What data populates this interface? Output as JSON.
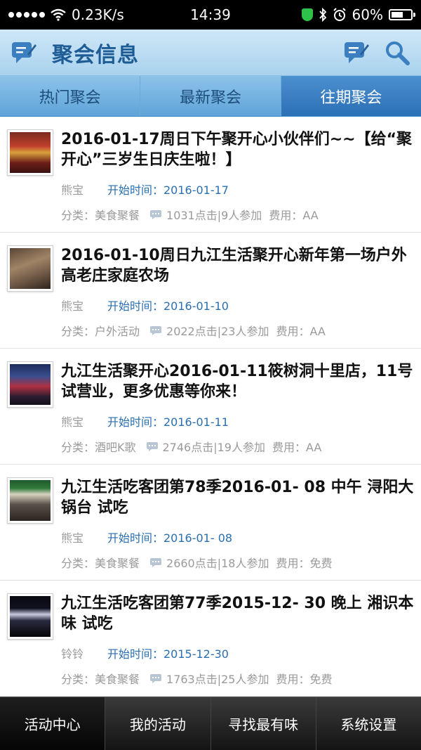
{
  "status": {
    "speed": "0.23K/s",
    "time": "14:39",
    "battery": "60%",
    "battery_level": 0.6
  },
  "header": {
    "title": "聚会信息"
  },
  "tabs": [
    {
      "label": "热门聚会"
    },
    {
      "label": "最新聚会"
    },
    {
      "label": "往期聚会"
    }
  ],
  "events": [
    {
      "title": "2016-01-17周日下午聚开心小伙伴们~~【给“聚开心”三岁生日庆生啦！】",
      "author": "熊宝",
      "start": "开始时间：2016-01-17",
      "category": "分类：美食聚餐",
      "stats": "1031点击|9人参加",
      "fee": "费用：AA"
    },
    {
      "title": "2016-01-10周日九江生活聚开心新年第一场户外 高老庄家庭农场",
      "author": "熊宝",
      "start": "开始时间：2016-01-10",
      "category": "分类：户外活动",
      "stats": "2022点击|23人参加",
      "fee": "费用：AA"
    },
    {
      "title": "九江生活聚开心2016-01-11筱树洞十里店，11号试营业，更多优惠等你来！",
      "author": "熊宝",
      "start": "开始时间：2016-01-11",
      "category": "分类：酒吧K歌",
      "stats": "2746点击|19人参加",
      "fee": "费用：AA"
    },
    {
      "title": "九江生活吃客团第78季2016-01- 08 中午 浔阳大锅台 试吃",
      "author": "熊宝",
      "start": "开始时间：2016-01- 08",
      "category": "分类：美食聚餐",
      "stats": "2660点击|18人参加",
      "fee": "费用：免费"
    },
    {
      "title": "九江生活吃客团第77季2015-12- 30 晚上 湘识本味 试吃",
      "author": "铃铃",
      "start": "开始时间：2015-12-30",
      "category": "分类：美食聚餐",
      "stats": "1763点击|25人参加",
      "fee": "费用：免费"
    }
  ],
  "bottom_nav": [
    {
      "label": "活动中心"
    },
    {
      "label": "我的活动"
    },
    {
      "label": "寻找最有味"
    },
    {
      "label": "系统设置"
    }
  ]
}
